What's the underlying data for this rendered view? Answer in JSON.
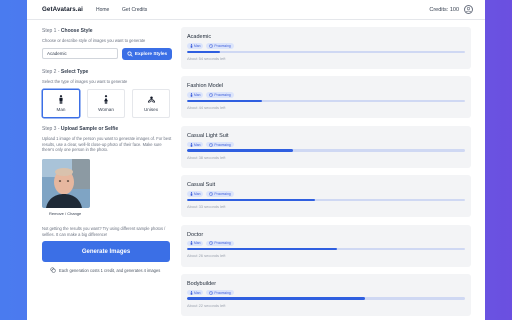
{
  "nav": {
    "brand": "GetAvatars.ai",
    "home": "Home",
    "get_credits": "Get Credits",
    "credits": "Credits: 100"
  },
  "step1": {
    "label": "Step 1 -",
    "title": "Choose Style",
    "help": "Choose or describe style of images you want to generate",
    "input_value": "Academic",
    "explore": "Explore Styles"
  },
  "step2": {
    "label": "Step 2 -",
    "title": "Select Type",
    "help": "Select the type of images you want to generate",
    "options": [
      "Man",
      "Woman",
      "Unisex"
    ],
    "selected": "Man"
  },
  "step3": {
    "label": "Step 3 -",
    "title": "Upload Sample or Selfie",
    "help": "Upload 1 image of the person you want to generate images of. For best results, use a clear, well-lit close-up photo of their face. Make sure there's only one person in the photo.",
    "remove": "Remove / Change",
    "tip": "Not getting the results you want? Try using different sample photos / selfies. It can make a big difference!"
  },
  "generate": "Generate Images",
  "footer": "Each generation costs 1 credit, and generates 4 images",
  "jobs": [
    {
      "title": "Academic",
      "badge1": "Man",
      "badge2": "Processing",
      "progress": 0.12,
      "eta": "About 54 seconds left"
    },
    {
      "title": "Fashion Model",
      "badge1": "Man",
      "badge2": "Processing",
      "progress": 0.27,
      "eta": "About 44 seconds left"
    },
    {
      "title": "Casual Light Suit",
      "badge1": "Man",
      "badge2": "Processing",
      "progress": 0.38,
      "eta": "About 38 seconds left"
    },
    {
      "title": "Casual Suit",
      "badge1": "Man",
      "badge2": "Processing",
      "progress": 0.46,
      "eta": "About 33 seconds left"
    },
    {
      "title": "Doctor",
      "badge1": "Man",
      "badge2": "Processing",
      "progress": 0.54,
      "eta": "About 26 seconds left"
    },
    {
      "title": "Bodybuilder",
      "badge1": "Man",
      "badge2": "Processing",
      "progress": 0.64,
      "eta": "About 22 seconds left"
    }
  ],
  "colors": {
    "accent": "#3b6fe6",
    "bar_bg": "#cfd8f3",
    "card_bg": "#f3f4f6"
  }
}
